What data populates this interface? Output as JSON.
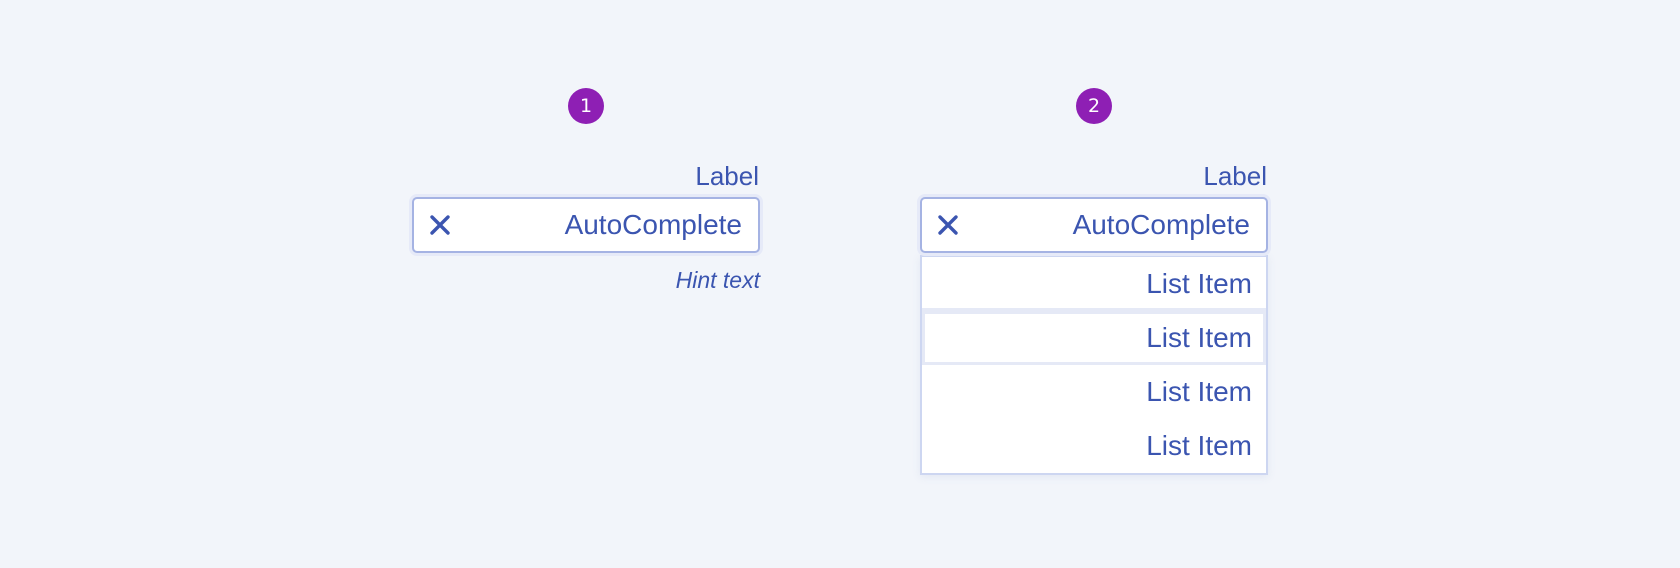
{
  "badges": [
    "1",
    "2"
  ],
  "example1": {
    "label": "Label",
    "value": "AutoComplete",
    "hint": "Hint text"
  },
  "example2": {
    "label": "Label",
    "value": "AutoComplete",
    "list_items": [
      "List Item",
      "List Item",
      "List Item",
      "List Item"
    ]
  },
  "colors": {
    "background": "#f2f5fa",
    "accent_text": "#3b55b0",
    "badge": "#8e1fb4",
    "field_border": "#a5b3e3"
  },
  "icons": {
    "clear": "close-icon"
  }
}
